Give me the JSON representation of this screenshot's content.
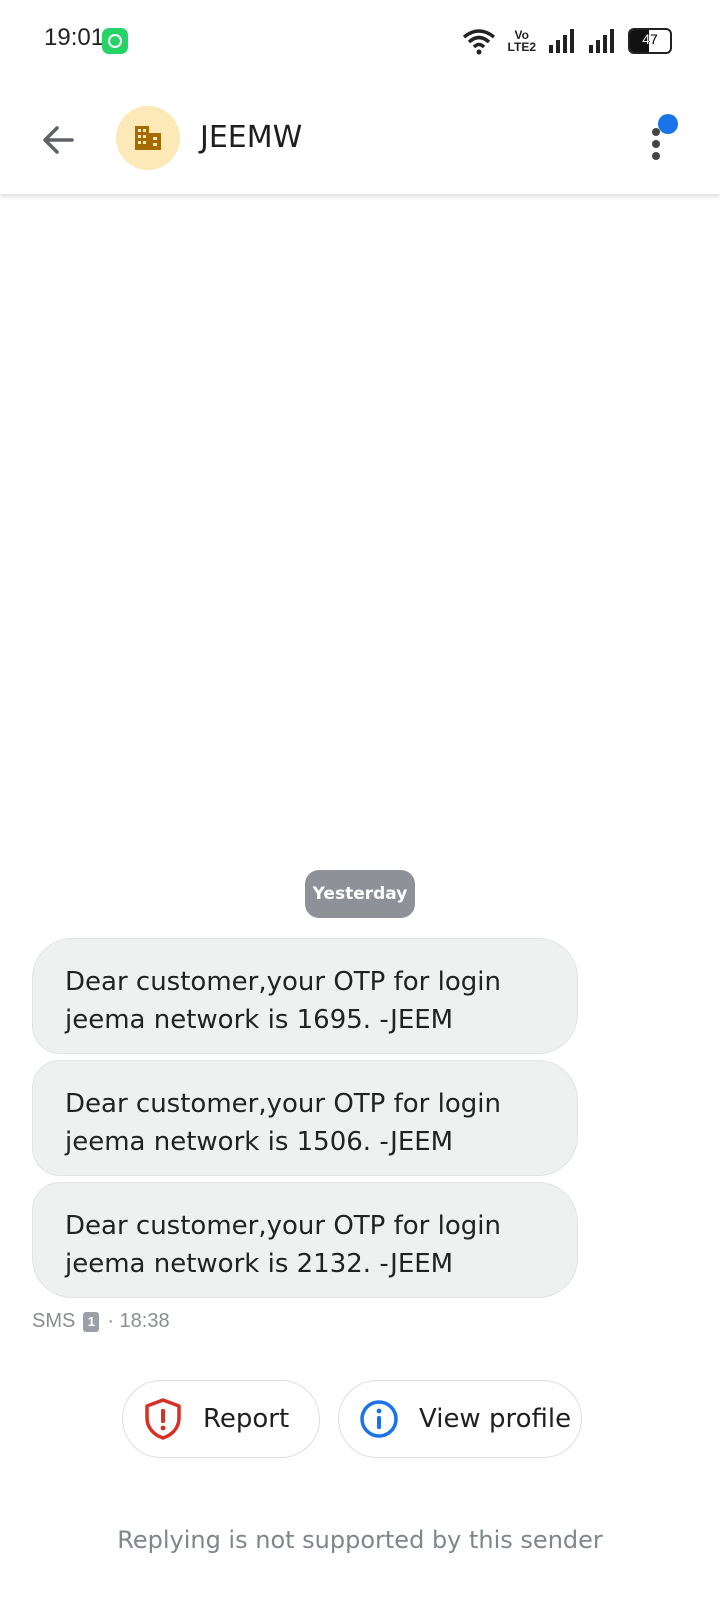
{
  "status_bar": {
    "time": "19:01",
    "network_label_top": "Vo",
    "network_label_bottom": "LTE2",
    "battery_level": "47",
    "icons": [
      "whatsapp-icon",
      "wifi-icon",
      "volte-icon",
      "signal-icon",
      "signal-icon",
      "battery-icon"
    ]
  },
  "header": {
    "contact_name": "JEEMW",
    "avatar_icon": "building-icon",
    "back_icon": "arrow-back-icon",
    "menu_icon": "more-vert-icon",
    "colors": {
      "avatar_bg": "#fde9b8",
      "avatar_icon": "#a56a00",
      "notify": "#1a73e8"
    }
  },
  "conversation": {
    "date_divider": "Yesterday",
    "messages": [
      {
        "text": "Dear customer,your OTP for login jeema network is 1695. -JEEM"
      },
      {
        "text": "Dear customer,your OTP for login jeema network is 1506. -JEEM"
      },
      {
        "text": "Dear customer,your OTP for login jeema network is 2132. -JEEM"
      }
    ],
    "meta": {
      "type": "SMS",
      "sim": "1",
      "time": "· 18:38"
    }
  },
  "actions": {
    "report_label": "Report",
    "view_profile_label": "View profile",
    "colors": {
      "report": "#d93025",
      "info": "#1a73e8"
    }
  },
  "footer": {
    "reply_note": "Replying is not supported by this sender"
  }
}
